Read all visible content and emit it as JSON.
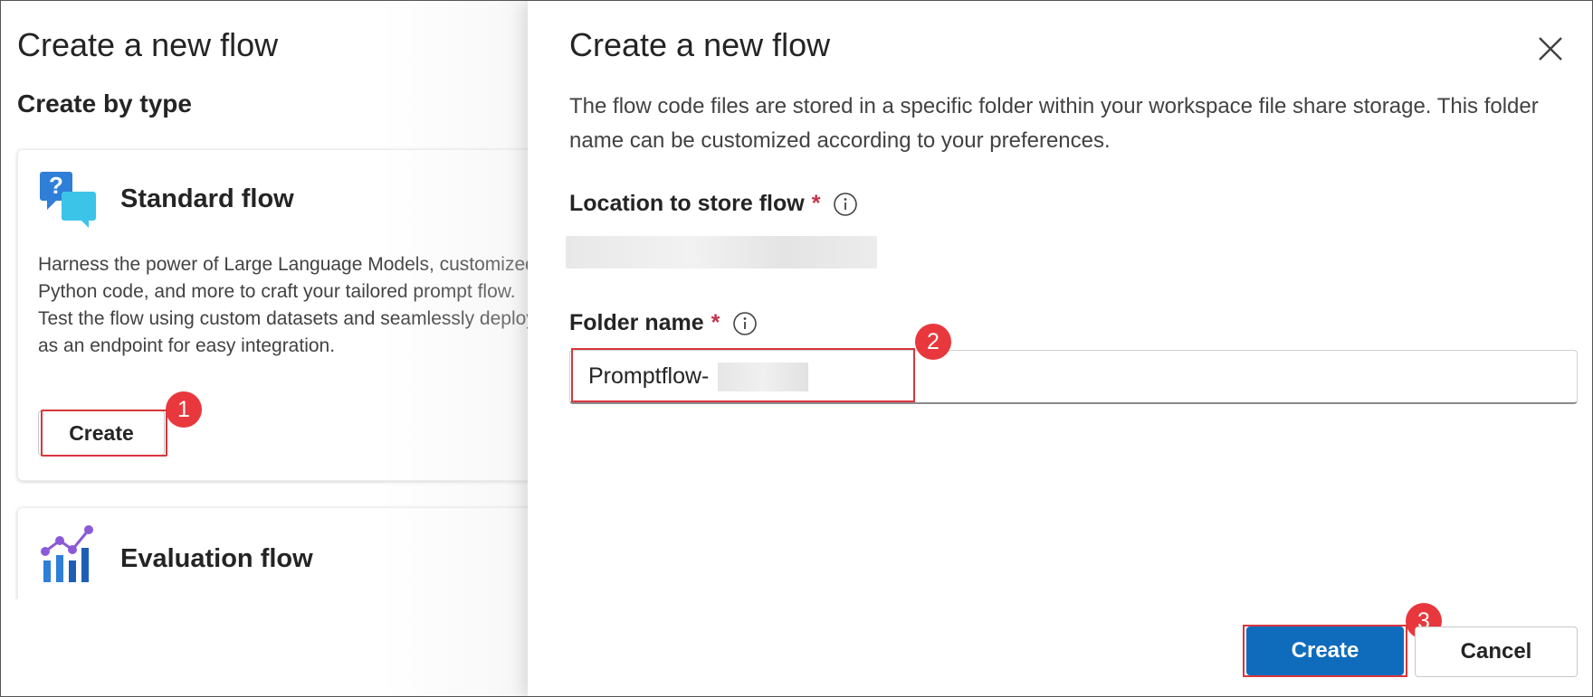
{
  "background_page": {
    "title": "Create a new flow",
    "subtitle": "Create by type",
    "cards": [
      {
        "title": "Standard flow",
        "icon": "chat-question-icon",
        "description": "Harness the power of Large Language Models, customized Python code, and more to craft your tailored prompt flow. Test the flow using custom datasets and seamlessly deploy as an endpoint for easy integration.",
        "button_label": "Create"
      },
      {
        "title": "Evaluation flow",
        "icon": "chart-evaluation-icon"
      }
    ]
  },
  "panel": {
    "title": "Create a new flow",
    "description": "The flow code files are stored in a specific folder within your workspace file share storage. This folder name can be customized according to your preferences.",
    "location_label": "Location to store flow",
    "folder_label": "Folder name",
    "required_marker": "*",
    "folder_value": "Promptflow-",
    "create_label": "Create",
    "cancel_label": "Cancel"
  },
  "annotations": {
    "step1": "1",
    "step2": "2",
    "step3": "3",
    "highlight_color": "#d9363e"
  },
  "colors": {
    "primary": "#0f6cbd",
    "badge": "#e8383d",
    "required": "#c4314b"
  }
}
